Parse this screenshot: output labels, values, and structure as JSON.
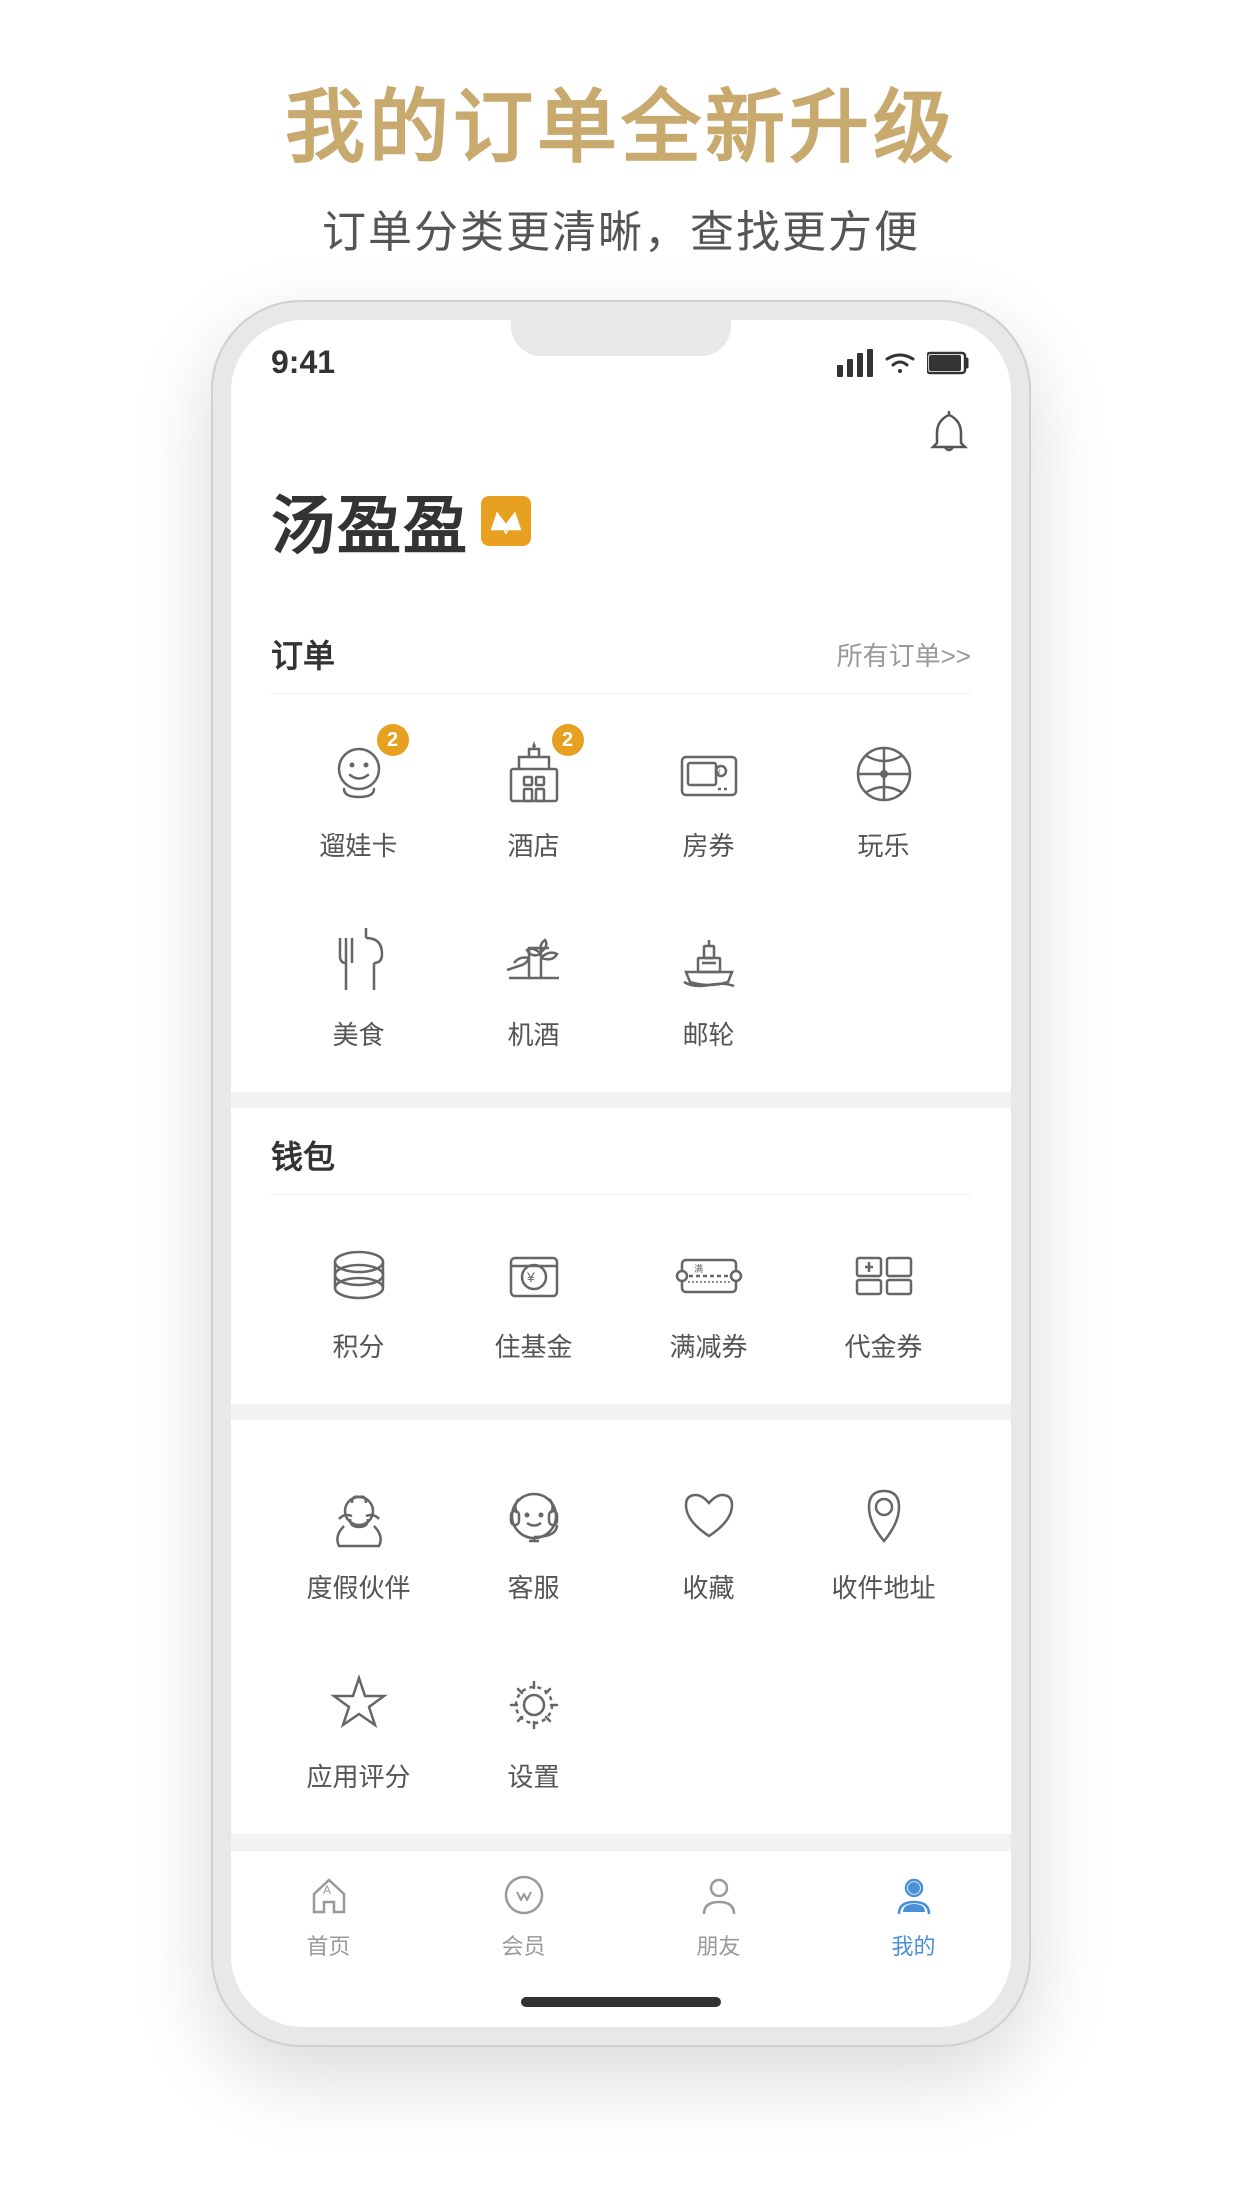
{
  "page": {
    "background": "#f5f5f5"
  },
  "promo": {
    "title": "我的订单全新升级",
    "subtitle": "订单分类更清晰，查找更方便"
  },
  "status_bar": {
    "time": "9:41"
  },
  "app": {
    "logo": "汤盈盈",
    "vip_badge": "V",
    "bell_label": "🔔"
  },
  "orders_section": {
    "title": "订单",
    "link": "所有订单>>",
    "items_row1": [
      {
        "label": "遛娃卡",
        "badge": "2",
        "icon": "baby"
      },
      {
        "label": "酒店",
        "badge": "2",
        "icon": "hotel"
      },
      {
        "label": "房券",
        "badge": "",
        "icon": "coupon"
      },
      {
        "label": "玩乐",
        "badge": "",
        "icon": "ferris"
      }
    ],
    "items_row2": [
      {
        "label": "美食",
        "badge": "",
        "icon": "food"
      },
      {
        "label": "机酒",
        "badge": "",
        "icon": "flight"
      },
      {
        "label": "邮轮",
        "badge": "",
        "icon": "cruise"
      }
    ]
  },
  "wallet_section": {
    "title": "钱包",
    "items": [
      {
        "label": "积分",
        "icon": "coins"
      },
      {
        "label": "住基金",
        "icon": "fund"
      },
      {
        "label": "满减券",
        "icon": "discount"
      },
      {
        "label": "代金券",
        "icon": "voucher"
      }
    ]
  },
  "extra_section": {
    "row1": [
      {
        "label": "度假伙伴",
        "icon": "partner"
      },
      {
        "label": "客服",
        "icon": "service"
      },
      {
        "label": "收藏",
        "icon": "favorite"
      },
      {
        "label": "收件地址",
        "icon": "address"
      }
    ],
    "row2": [
      {
        "label": "应用评分",
        "icon": "star"
      },
      {
        "label": "设置",
        "icon": "settings"
      }
    ]
  },
  "bottom_nav": {
    "items": [
      {
        "label": "首页",
        "icon": "home",
        "active": false
      },
      {
        "label": "会员",
        "icon": "member",
        "active": false
      },
      {
        "label": "朋友",
        "icon": "friends",
        "active": false
      },
      {
        "label": "我的",
        "icon": "mine",
        "active": true
      }
    ]
  }
}
